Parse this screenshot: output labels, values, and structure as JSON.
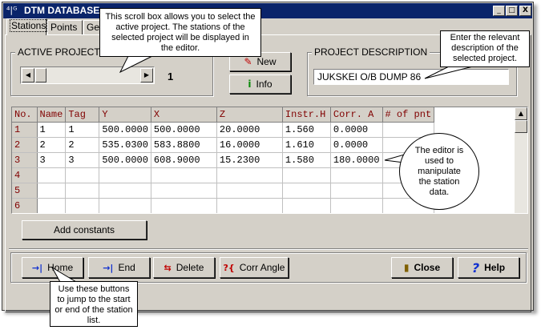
{
  "window": {
    "title": "DTM DATABASE",
    "controls": {
      "minimize": "_",
      "maximize": "□",
      "close": "X"
    }
  },
  "tabs": [
    {
      "label": "Stations",
      "active": true
    },
    {
      "label": "Points",
      "active": false
    },
    {
      "label": "Gen",
      "active": false
    }
  ],
  "active_project": {
    "group_label": "ACTIVE PROJECT",
    "value": "1"
  },
  "project_buttons": {
    "new": "New",
    "info": "Info"
  },
  "project_description": {
    "group_label": "PROJECT DESCRIPTION",
    "value": "JUKSKEI O/B DUMP 86"
  },
  "grid": {
    "columns": [
      "No.",
      "Name",
      "Tag",
      "Y",
      "X",
      "Z",
      "Instr.H",
      "Corr. A",
      "# of pnt"
    ],
    "rows": [
      {
        "no": "1",
        "cells": [
          "1",
          "1",
          "500.0000",
          "500.0000",
          "20.0000",
          "1.560",
          "0.0000",
          ""
        ]
      },
      {
        "no": "2",
        "cells": [
          "2",
          "2",
          "535.0300",
          "583.8800",
          "16.0000",
          "1.610",
          "0.0000",
          ""
        ]
      },
      {
        "no": "3",
        "cells": [
          "3",
          "3",
          "500.0000",
          "608.9000",
          "15.2300",
          "1.580",
          "180.0000",
          ""
        ]
      },
      {
        "no": "4",
        "cells": [
          "",
          "",
          "",
          "",
          "",
          "",
          "",
          ""
        ]
      },
      {
        "no": "5",
        "cells": [
          "",
          "",
          "",
          "",
          "",
          "",
          "",
          ""
        ]
      },
      {
        "no": "6",
        "cells": [
          "",
          "",
          "",
          "",
          "",
          "",
          "",
          ""
        ]
      }
    ]
  },
  "add_constants": "Add constants",
  "nav_buttons": {
    "home": "Home",
    "end": "End",
    "delete": "Delete",
    "corr_angle": "Corr Angle"
  },
  "action_buttons": {
    "close": "Close",
    "help": "Help"
  },
  "callouts": {
    "scroll": "This scroll box allows you to select the active project. The stations of the selected project will be displayed in the editor.",
    "description": "Enter the relevant description of the selected project.",
    "editor": "The editor is used to manipulate the station data.",
    "buttons": "Use these buttons to jump to the start or end of the station list."
  },
  "colors": {
    "titlebar": "#0a246a",
    "header_text": "#800000",
    "face": "#d4d0c8"
  }
}
